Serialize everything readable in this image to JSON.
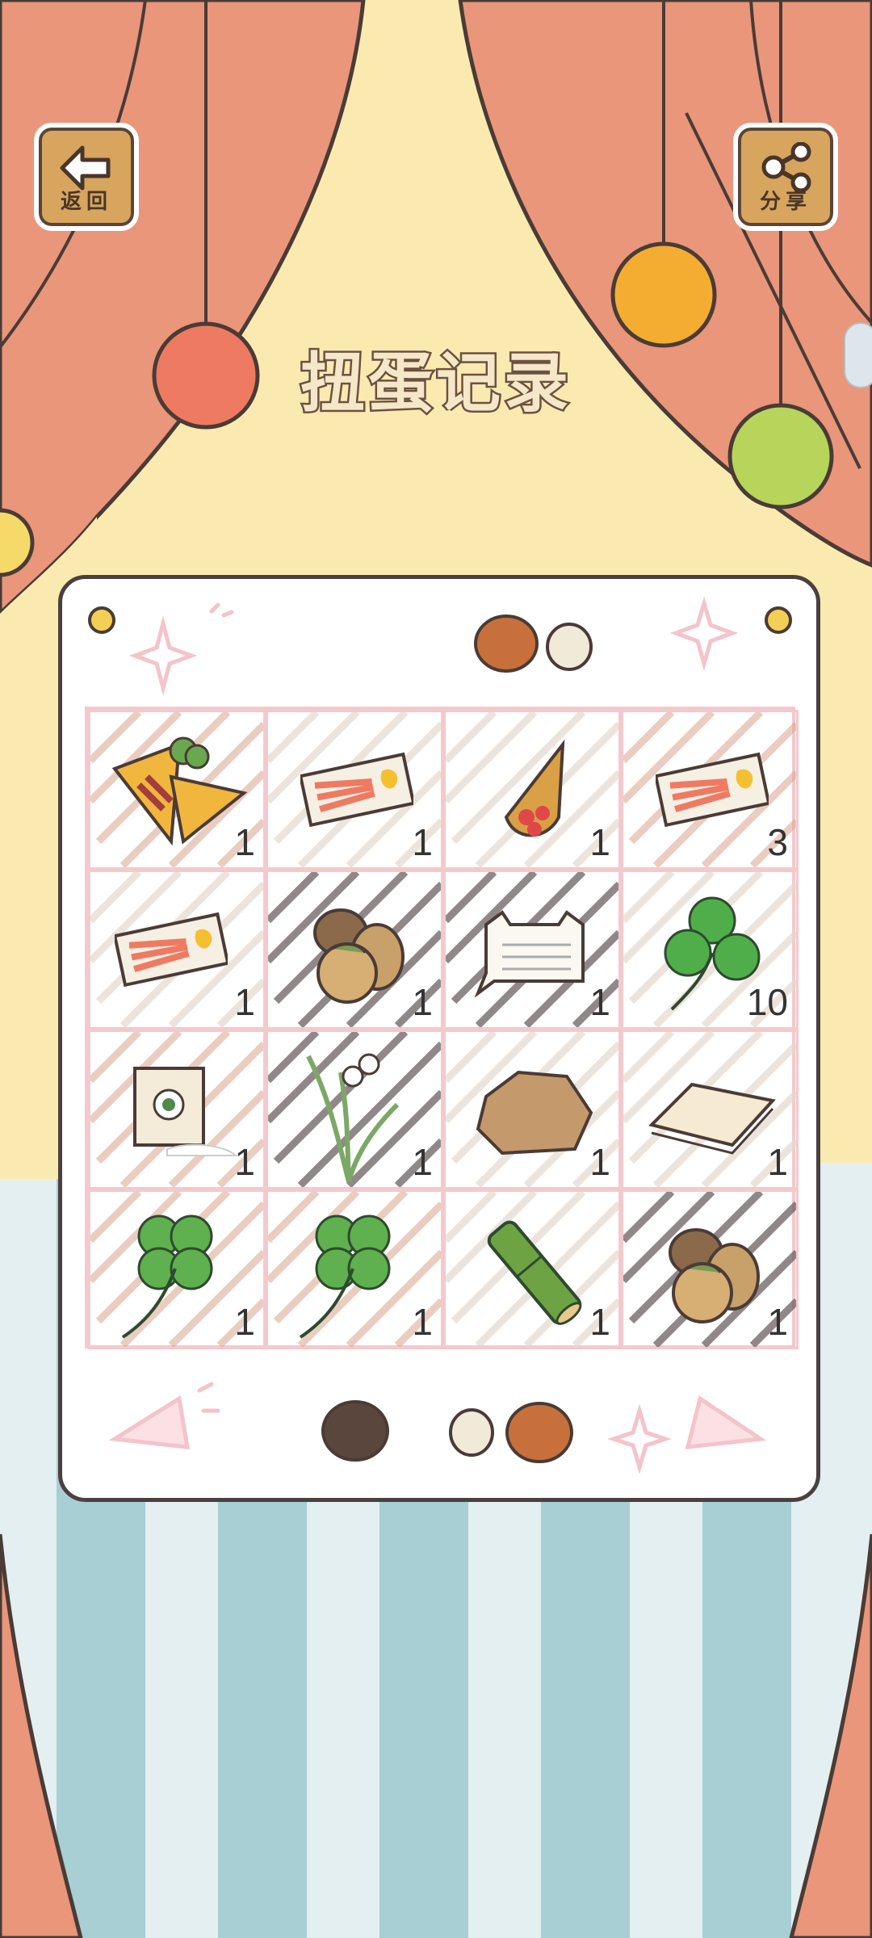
{
  "header": {
    "back_label": "返回",
    "share_label": "分享",
    "title": "扭蛋记录"
  },
  "colors": {
    "curtain": "#e9967a",
    "backdrop": "#fbeab0",
    "stripe_light": "#e3eff1",
    "stripe_dark": "#a8cfd3",
    "button_wood": "#d8a55f",
    "grid_border": "#f4c9cd"
  },
  "items": [
    {
      "name": "samosa-bread",
      "icon": "samosa-icon",
      "count": "1"
    },
    {
      "name": "ticket",
      "icon": "ticket-icon",
      "count": "1"
    },
    {
      "name": "crepe",
      "icon": "crepe-icon",
      "count": "1"
    },
    {
      "name": "ticket",
      "icon": "ticket-icon",
      "count": "3"
    },
    {
      "name": "ticket",
      "icon": "ticket-icon",
      "count": "1"
    },
    {
      "name": "acorns",
      "icon": "acorn-icon",
      "count": "1"
    },
    {
      "name": "letter",
      "icon": "letter-icon",
      "count": "1"
    },
    {
      "name": "three-leaf-clover",
      "icon": "clover-icon",
      "count": "10"
    },
    {
      "name": "flour-bag",
      "icon": "flour-bag-icon",
      "count": "1"
    },
    {
      "name": "orchid",
      "icon": "orchid-icon",
      "count": "1"
    },
    {
      "name": "rock",
      "icon": "rock-icon",
      "count": "1"
    },
    {
      "name": "paper",
      "icon": "paper-icon",
      "count": "1"
    },
    {
      "name": "four-leaf-clover",
      "icon": "four-leaf-clover-icon",
      "count": "1"
    },
    {
      "name": "four-leaf-clover",
      "icon": "four-leaf-clover-icon",
      "count": "1"
    },
    {
      "name": "bamboo",
      "icon": "bamboo-icon",
      "count": "1"
    },
    {
      "name": "acorns",
      "icon": "acorn-icon",
      "count": "1"
    }
  ]
}
